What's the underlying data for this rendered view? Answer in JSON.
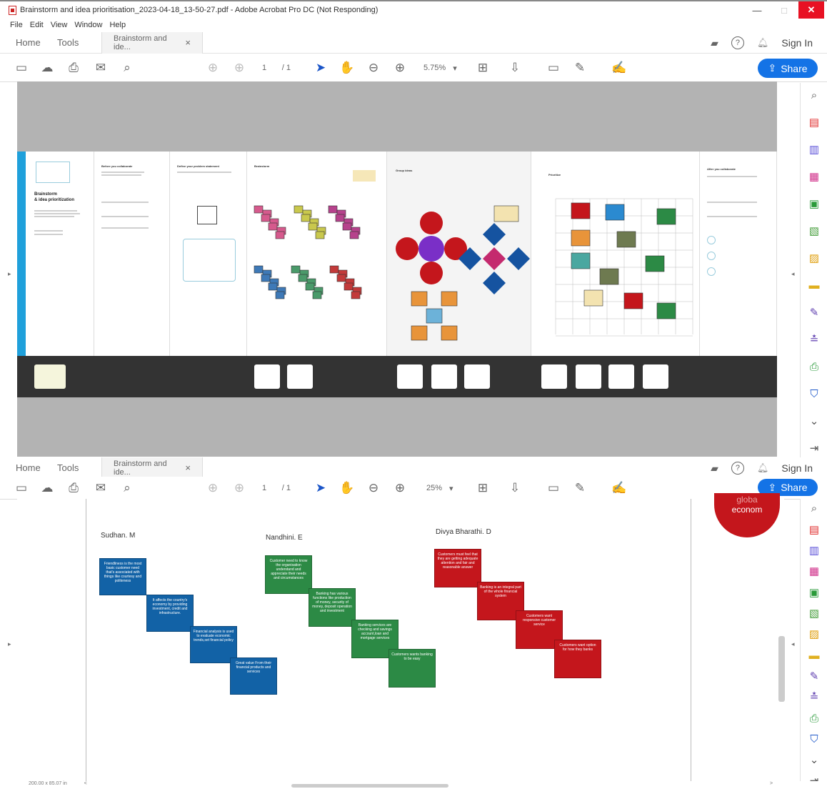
{
  "window": {
    "title": "Brainstorm and idea prioritisation_2023-04-18_13-50-27.pdf - Adobe Acrobat Pro DC (Not Responding)",
    "minimize": "—",
    "maximize": "□",
    "close": "✕"
  },
  "menu": [
    "File",
    "Edit",
    "View",
    "Window",
    "Help"
  ],
  "tabs": {
    "home": "Home",
    "tools": "Tools",
    "document": "Brainstorm and ide...",
    "doc_close": "×",
    "sign_in": "Sign In"
  },
  "toolbar_top": {
    "page_current": "1",
    "page_total": "/ 1",
    "zoom": "5.75%",
    "share": "Share"
  },
  "toolbar_bottom": {
    "page_current": "1",
    "page_total": "/ 1",
    "zoom": "25%",
    "share": "Share"
  },
  "template": {
    "title_line1": "Brainstorm",
    "title_line2": "& idea prioritization",
    "sections": [
      "Before you collaborate",
      "Define your problem statement",
      "Brainstorm",
      "Group ideas",
      "Prioritize",
      "After you collaborate"
    ]
  },
  "brainstorm": {
    "people": [
      {
        "name": "Sudhan. M",
        "notes": [
          "Friendliness is the most basic customer need that's associated with things like courtesy and politeness",
          "It affects the country's economy by providing investment, credit and infrastructure.",
          "Financial analysis is used to evaluate economic trends,set financial policy",
          "Great value From their financial products and services"
        ]
      },
      {
        "name": "Nandhini. E",
        "notes": [
          "Customer need to know the organisation understand and appreciate their needs and circumstances",
          "Banking has various functions like production of money, security of money, deposit operation and investment",
          "Banking services are checking and savings account,loan and mortgage services",
          "Customers wants banking to be easy"
        ]
      },
      {
        "name": "Divya Bharathi. D",
        "notes": [
          "Customers must feel that they are getting adequate attention and fair and reasonable answer",
          "Banking is an integral part of the whole financial system",
          "Customers want responsive customer service",
          "Customers want option for how they banks"
        ]
      }
    ],
    "corner_text_line1": "globa",
    "corner_text_line2": "econom"
  },
  "status": {
    "dimensions": "200.00 x 85.07 in",
    "scroll_left": "<",
    "scroll_right": ">"
  },
  "colors": {
    "blue_note": "#1262a6",
    "green_note": "#2c8a45",
    "red_note": "#c4161c",
    "share": "#1473e6"
  },
  "icons": {
    "right_panel": [
      "search-zoom-icon",
      "export-pdf-icon",
      "edit-pdf-icon",
      "organize-pages-icon",
      "create-pdf-icon",
      "combine-files-icon",
      "send-for-review-icon",
      "comment-icon",
      "fill-sign-icon",
      "enhance-scans-icon",
      "print-production-icon",
      "protect-icon",
      "more-tools-icon",
      "collapse-panel-icon"
    ]
  }
}
